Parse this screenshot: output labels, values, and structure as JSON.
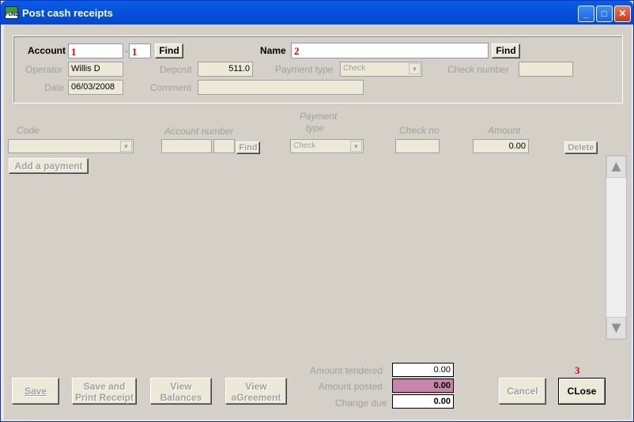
{
  "window": {
    "title": "Post cash receipts",
    "icon_text_top": "",
    "icon_text_bottom": "FUND"
  },
  "header": {
    "account_label": "Account",
    "account_marker": "1",
    "account_suffix_marker": "1",
    "account_find": "Find",
    "name_label": "Name",
    "name_marker": "2",
    "name_find": "Find",
    "operator_label": "Operator",
    "operator_value": "Willis D",
    "deposit_label": "Deposit",
    "deposit_value": "511.0",
    "payment_type_label": "Payment type",
    "payment_type_value": "Check",
    "check_number_label": "Check number",
    "date_label": "Date",
    "date_value": "06/03/2008",
    "comment_label": "Comment"
  },
  "grid": {
    "code_label": "Code",
    "account_number_label": "Account number",
    "payment_type_label_line1": "Payment",
    "payment_type_label_line2": "type",
    "check_no_label": "Check no",
    "amount_label": "Amount",
    "payment_type_value": "Check",
    "find_label": "Find",
    "amount_value": "0.00",
    "delete_label": "Delete",
    "add_payment_label": "Add a payment"
  },
  "totals": {
    "tendered_label": "Amount tendered",
    "tendered_value": "0.00",
    "posted_label": "Amount posted",
    "posted_value": "0.00",
    "change_label": "Change due",
    "change_value": "0.00"
  },
  "buttons": {
    "save": "Save",
    "save_print_1": "Save and",
    "save_print_2": "Print Receipt",
    "view_balances_1": "View",
    "view_balances_2": "Balances",
    "view_agreement_1": "View",
    "view_agreement_2": "aGreement",
    "cancel": "Cancel",
    "close": "CLose",
    "close_marker": "3"
  }
}
